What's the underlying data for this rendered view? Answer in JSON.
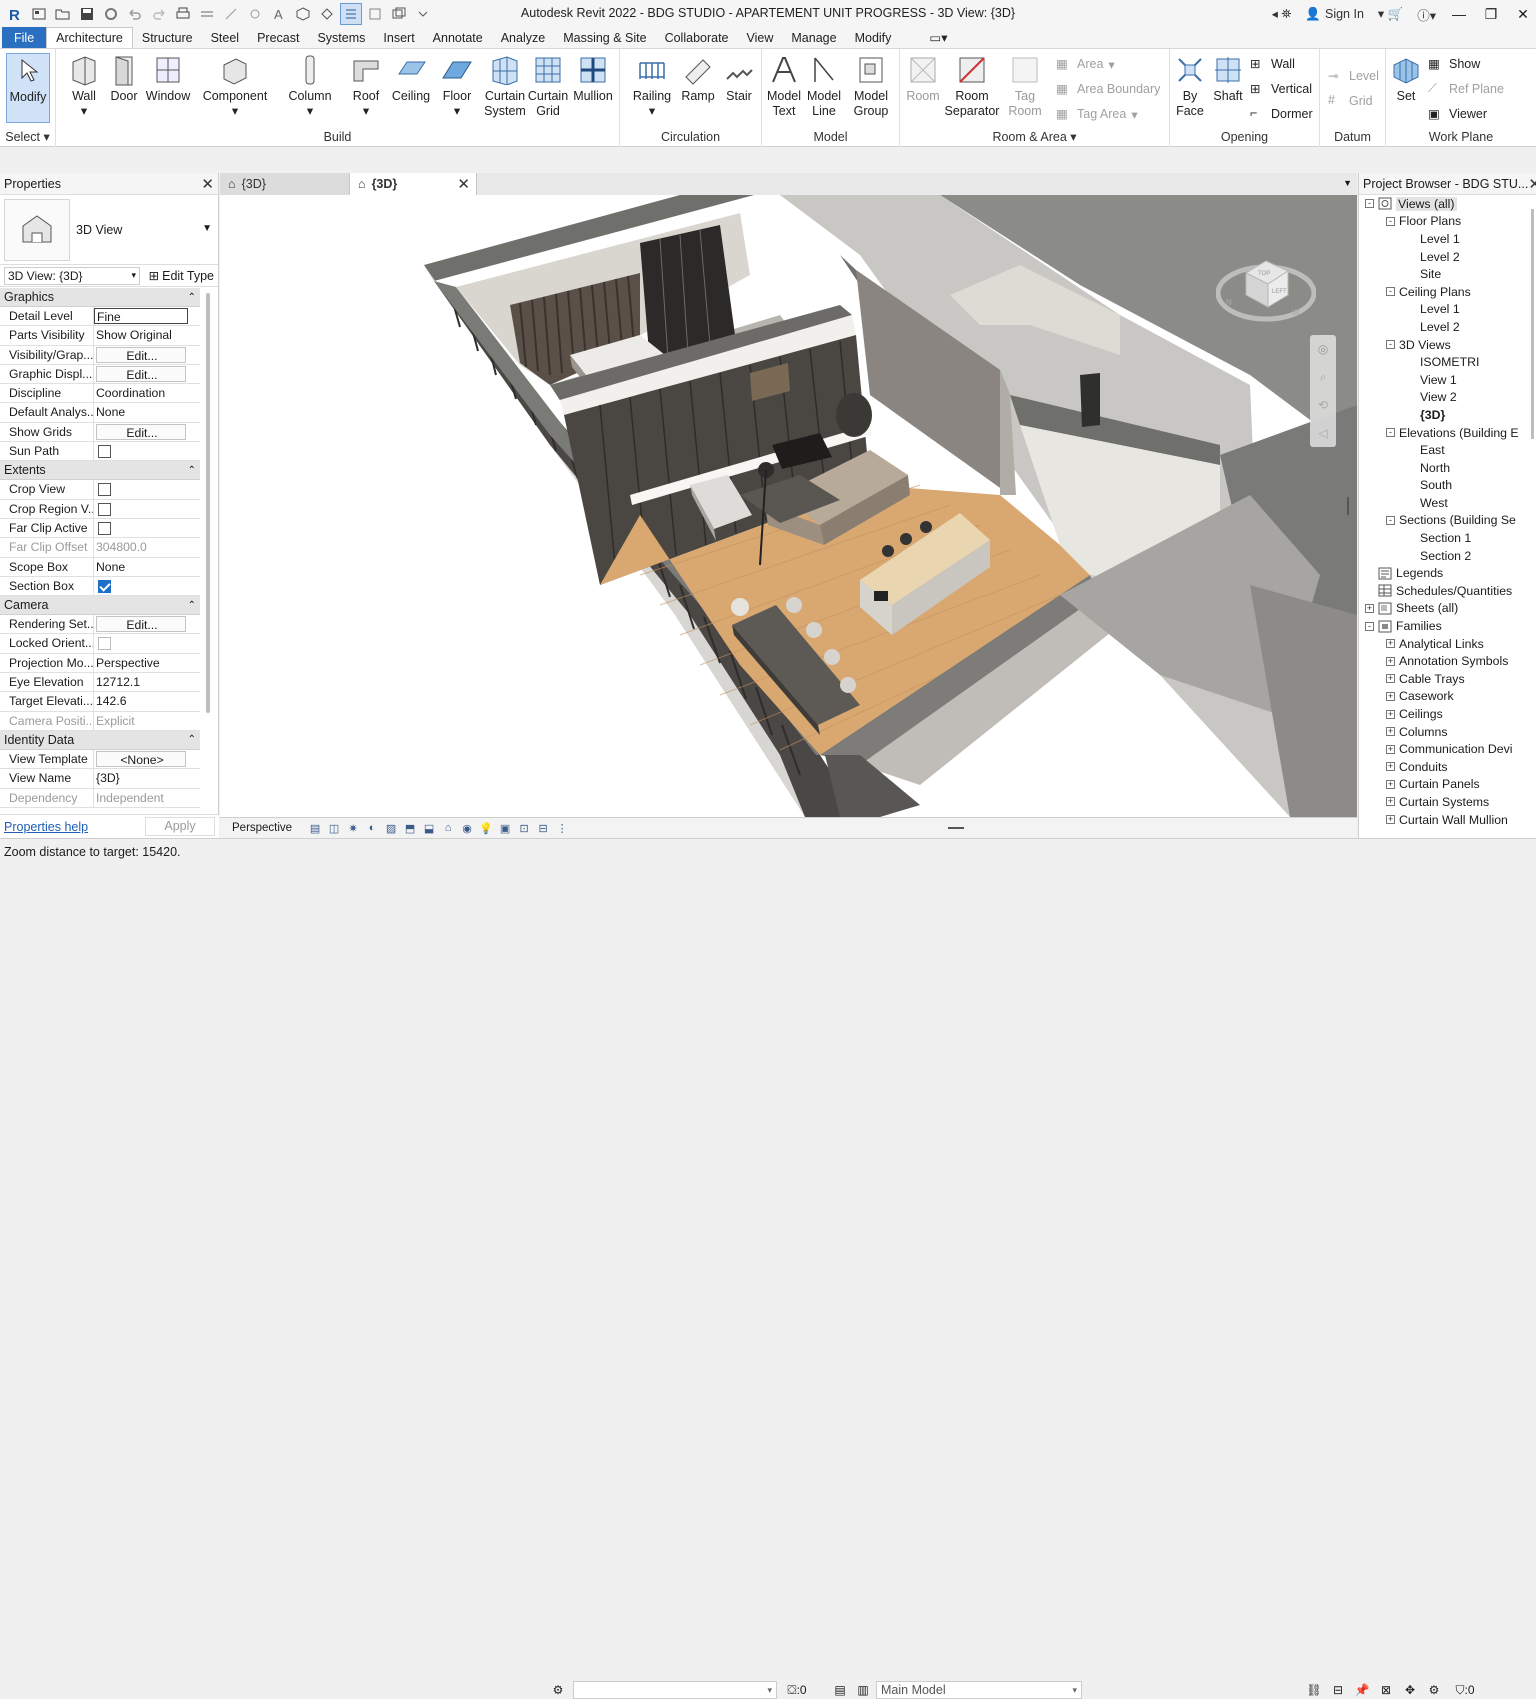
{
  "window": {
    "title": "Autodesk Revit 2022 - BDG STUDIO - APARTEMENT UNIT PROGRESS - 3D View: {3D}",
    "sign_in": "Sign In"
  },
  "tabs": [
    "File",
    "Architecture",
    "Structure",
    "Steel",
    "Precast",
    "Systems",
    "Insert",
    "Annotate",
    "Analyze",
    "Massing & Site",
    "Collaborate",
    "View",
    "Manage",
    "Modify"
  ],
  "ribbon": {
    "select": {
      "modify": "Modify",
      "label": "Select"
    },
    "build": {
      "label": "Build",
      "wall": "Wall",
      "door": "Door",
      "window": "Window",
      "component": "Component",
      "column": "Column",
      "roof": "Roof",
      "ceiling": "Ceiling",
      "floor": "Floor",
      "curtain_system": [
        "Curtain",
        "System"
      ],
      "curtain_grid": [
        "Curtain",
        "Grid"
      ],
      "mullion": "Mullion"
    },
    "circulation": {
      "label": "Circulation",
      "railing": "Railing",
      "ramp": "Ramp",
      "stair": "Stair"
    },
    "model": {
      "label": "Model",
      "model_text": [
        "Model",
        "Text"
      ],
      "model_line": [
        "Model",
        "Line"
      ],
      "model_group": [
        "Model",
        "Group"
      ]
    },
    "room_area": {
      "label": "Room & Area",
      "room": "Room",
      "room_separator": [
        "Room",
        "Separator"
      ],
      "tag_room": [
        "Tag",
        "Room"
      ],
      "area": "Area",
      "area_boundary": "Area  Boundary",
      "tag_area": "Tag  Area"
    },
    "opening": {
      "label": "Opening",
      "by_face": [
        "By",
        "Face"
      ],
      "shaft": "Shaft",
      "wall": "Wall",
      "vertical": "Vertical",
      "dormer": "Dormer"
    },
    "datum": {
      "label": "Datum",
      "level": "Level",
      "grid": "Grid"
    },
    "work_plane": {
      "label": "Work Plane",
      "set": "Set",
      "show": "Show",
      "ref_plane": "Ref  Plane",
      "viewer": "Viewer"
    }
  },
  "properties": {
    "title": "Properties",
    "type_name": "3D View",
    "selector": "3D View: {3D}",
    "edit_type": "Edit Type",
    "categories": [
      {
        "name": "Graphics",
        "rows": [
          {
            "k": "Detail Level",
            "v": "Fine",
            "style": "boxed"
          },
          {
            "k": "Parts Visibility",
            "v": "Show Original"
          },
          {
            "k": "Visibility/Grap...",
            "v": "Edit...",
            "style": "btn"
          },
          {
            "k": "Graphic Displ...",
            "v": "Edit...",
            "style": "btn"
          },
          {
            "k": "Discipline",
            "v": "Coordination"
          },
          {
            "k": "Default Analys...",
            "v": "None"
          },
          {
            "k": "Show Grids",
            "v": "Edit...",
            "style": "btn"
          },
          {
            "k": "Sun Path",
            "v": "",
            "style": "cb"
          }
        ]
      },
      {
        "name": "Extents",
        "rows": [
          {
            "k": "Crop View",
            "v": "",
            "style": "cb"
          },
          {
            "k": "Crop Region V...",
            "v": "",
            "style": "cb"
          },
          {
            "k": "Far Clip Active",
            "v": "",
            "style": "cb"
          },
          {
            "k": "Far Clip Offset",
            "v": "304800.0",
            "style": "dim"
          },
          {
            "k": "Scope Box",
            "v": "None"
          },
          {
            "k": "Section Box",
            "v": "",
            "style": "cbchecked"
          }
        ]
      },
      {
        "name": "Camera",
        "rows": [
          {
            "k": "Rendering Set...",
            "v": "Edit...",
            "style": "btn"
          },
          {
            "k": "Locked Orient...",
            "v": "",
            "style": "cbdim"
          },
          {
            "k": "Projection Mo...",
            "v": "Perspective"
          },
          {
            "k": "Eye Elevation",
            "v": "12712.1"
          },
          {
            "k": "Target Elevati...",
            "v": "142.6"
          },
          {
            "k": "Camera Positi...",
            "v": "Explicit",
            "style": "dim"
          }
        ]
      },
      {
        "name": "Identity Data",
        "rows": [
          {
            "k": "View Template",
            "v": "<None>",
            "style": "btn"
          },
          {
            "k": "View Name",
            "v": "{3D}"
          },
          {
            "k": "Dependency",
            "v": "Independent",
            "style": "dim"
          }
        ]
      }
    ],
    "help": "Properties help",
    "apply": "Apply"
  },
  "view_tabs": [
    {
      "label": "{3D}",
      "active": false
    },
    {
      "label": "{3D}",
      "active": true
    }
  ],
  "view_control": {
    "mode": "Perspective"
  },
  "viewcube": {
    "top": "TOP",
    "left": "LEFT",
    "n": "N",
    "w": "W"
  },
  "browser": {
    "title": "Project Browser - BDG STU...",
    "tree": [
      {
        "d": 0,
        "t": "Views (all)",
        "box": "-",
        "icon": "views",
        "sel": true
      },
      {
        "d": 1,
        "t": "Floor Plans",
        "box": "-"
      },
      {
        "d": 2,
        "t": "Level 1"
      },
      {
        "d": 2,
        "t": "Level 2"
      },
      {
        "d": 2,
        "t": "Site"
      },
      {
        "d": 1,
        "t": "Ceiling Plans",
        "box": "-"
      },
      {
        "d": 2,
        "t": "Level 1"
      },
      {
        "d": 2,
        "t": "Level 2"
      },
      {
        "d": 1,
        "t": "3D Views",
        "box": "-"
      },
      {
        "d": 2,
        "t": "ISOMETRI"
      },
      {
        "d": 2,
        "t": "View 1"
      },
      {
        "d": 2,
        "t": "View 2"
      },
      {
        "d": 2,
        "t": "{3D}",
        "bold": true
      },
      {
        "d": 1,
        "t": "Elevations (Building E",
        "box": "-"
      },
      {
        "d": 2,
        "t": "East"
      },
      {
        "d": 2,
        "t": "North"
      },
      {
        "d": 2,
        "t": "South"
      },
      {
        "d": 2,
        "t": "West"
      },
      {
        "d": 1,
        "t": "Sections (Building Se",
        "box": "-"
      },
      {
        "d": 2,
        "t": "Section 1"
      },
      {
        "d": 2,
        "t": "Section 2"
      },
      {
        "d": 0,
        "t": "Legends",
        "icon": "legend"
      },
      {
        "d": 0,
        "t": "Schedules/Quantities",
        "icon": "schedule"
      },
      {
        "d": 0,
        "t": "Sheets (all)",
        "box": "+",
        "icon": "sheet"
      },
      {
        "d": 0,
        "t": "Families",
        "box": "-",
        "icon": "family"
      },
      {
        "d": 1,
        "t": "Analytical Links",
        "box": "+"
      },
      {
        "d": 1,
        "t": "Annotation Symbols",
        "box": "+"
      },
      {
        "d": 1,
        "t": "Cable Trays",
        "box": "+"
      },
      {
        "d": 1,
        "t": "Casework",
        "box": "+"
      },
      {
        "d": 1,
        "t": "Ceilings",
        "box": "+"
      },
      {
        "d": 1,
        "t": "Columns",
        "box": "+"
      },
      {
        "d": 1,
        "t": "Communication Devi",
        "box": "+"
      },
      {
        "d": 1,
        "t": "Conduits",
        "box": "+"
      },
      {
        "d": 1,
        "t": "Curtain Panels",
        "box": "+"
      },
      {
        "d": 1,
        "t": "Curtain Systems",
        "box": "+"
      },
      {
        "d": 1,
        "t": "Curtain Wall Mullion",
        "box": "+"
      }
    ]
  },
  "status": {
    "text": "Zoom distance to target: 15420.",
    "workset_value": ":0",
    "model": "Main Model",
    "filter_count": ":0"
  },
  "colors": {
    "file_tab": "#2b6fc1",
    "floor": "#d9a871",
    "wall_top": "#6f6f6c",
    "wall_face": "#efede8",
    "panel_dark": "#3e3a36"
  }
}
